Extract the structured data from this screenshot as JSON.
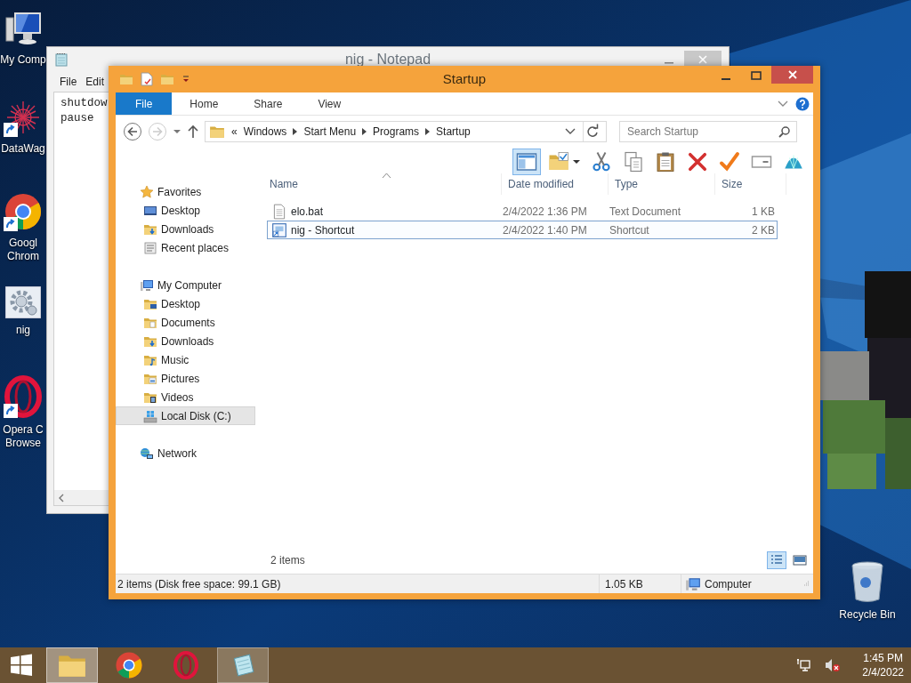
{
  "desktop_icons": [
    {
      "label": [
        "My Comp"
      ],
      "kind": "computer",
      "shortcut": false
    },
    {
      "label": [
        "DataWag"
      ],
      "kind": "starburst",
      "shortcut": true
    },
    {
      "label": [
        "Googl",
        "Chrom"
      ],
      "kind": "browser",
      "shortcut": true
    },
    {
      "label": [
        "nig"
      ],
      "kind": "gear",
      "shortcut": false
    },
    {
      "label": [
        "Opera C",
        "Browse"
      ],
      "kind": "ring",
      "shortcut": true
    }
  ],
  "recycle_bin": {
    "label": "Recycle Bin"
  },
  "notepad": {
    "title": "nig - Notepad",
    "menu": [
      "File",
      "Edit"
    ],
    "lines": [
      "shutdow",
      "pause"
    ]
  },
  "explorer": {
    "title": "Startup",
    "ribbon_tabs": [
      {
        "label": "File",
        "selected": true
      },
      {
        "label": "Home",
        "selected": false
      },
      {
        "label": "Share",
        "selected": false
      },
      {
        "label": "View",
        "selected": false
      }
    ],
    "address": {
      "overflow": "«",
      "segments": [
        "Windows",
        "Start Menu",
        "Programs",
        "Startup"
      ]
    },
    "search": {
      "placeholder": "Search Startup"
    },
    "toolbar": [
      {
        "kind": "preview-pane",
        "selected": true
      },
      {
        "kind": "folder-check",
        "selected": false
      },
      {
        "kind": "cut",
        "selected": false
      },
      {
        "kind": "copy",
        "selected": false
      },
      {
        "kind": "paste",
        "selected": false
      },
      {
        "kind": "delete",
        "selected": false
      },
      {
        "kind": "check",
        "selected": false
      },
      {
        "kind": "rename",
        "selected": false
      },
      {
        "kind": "shell",
        "selected": false
      }
    ],
    "nav": [
      {
        "label": "Favorites",
        "kind": "star",
        "selected": false,
        "children": [
          {
            "label": "Desktop",
            "kind": "desktop",
            "selected": false
          },
          {
            "label": "Downloads",
            "kind": "folder-down",
            "selected": false
          },
          {
            "label": "Recent places",
            "kind": "recent",
            "selected": false
          }
        ]
      },
      {
        "label": "My Computer",
        "kind": "computer",
        "selected": false,
        "children": [
          {
            "label": "Desktop",
            "kind": "folder-desktop",
            "selected": false
          },
          {
            "label": "Documents",
            "kind": "folder-doc",
            "selected": false
          },
          {
            "label": "Downloads",
            "kind": "folder-down",
            "selected": false
          },
          {
            "label": "Music",
            "kind": "folder-music",
            "selected": false
          },
          {
            "label": "Pictures",
            "kind": "folder-picture",
            "selected": false
          },
          {
            "label": "Videos",
            "kind": "folder-video",
            "selected": false
          },
          {
            "label": "Local Disk (C:)",
            "kind": "disk",
            "selected": true
          }
        ]
      },
      {
        "label": "Network",
        "kind": "network",
        "selected": false
      }
    ],
    "columns": [
      {
        "label": "Name",
        "sorted": true
      },
      {
        "label": "Date modified",
        "sorted": false
      },
      {
        "label": "Type",
        "sorted": false
      },
      {
        "label": "Size",
        "sorted": false
      }
    ],
    "rows": [
      {
        "kind": "text",
        "name": "elo.bat",
        "date": "2/4/2022 1:36 PM",
        "type": "Text Document",
        "size": "1 KB",
        "selected": false
      },
      {
        "kind": "shortcut",
        "name": "nig - Shortcut",
        "date": "2/4/2022 1:40 PM",
        "type": "Shortcut",
        "size": "2 KB",
        "selected": true
      }
    ],
    "item_count": "2 items",
    "view_buttons": [
      {
        "kind": "details",
        "selected": true
      },
      {
        "kind": "large-icons",
        "selected": false
      }
    ],
    "status_bar": {
      "summary": "2 items (Disk free space: 99.1 GB)",
      "size": "1.05 KB",
      "location": "Computer"
    }
  },
  "taskbar": {
    "apps": [
      {
        "kind": "explorer",
        "open": true,
        "active": true
      },
      {
        "kind": "browser",
        "open": false,
        "active": false
      },
      {
        "kind": "ring",
        "open": false,
        "active": false
      },
      {
        "kind": "notepad",
        "open": true,
        "active": false
      }
    ],
    "volume_muted": true,
    "time": "1:45 PM",
    "date": "2/4/2022"
  }
}
